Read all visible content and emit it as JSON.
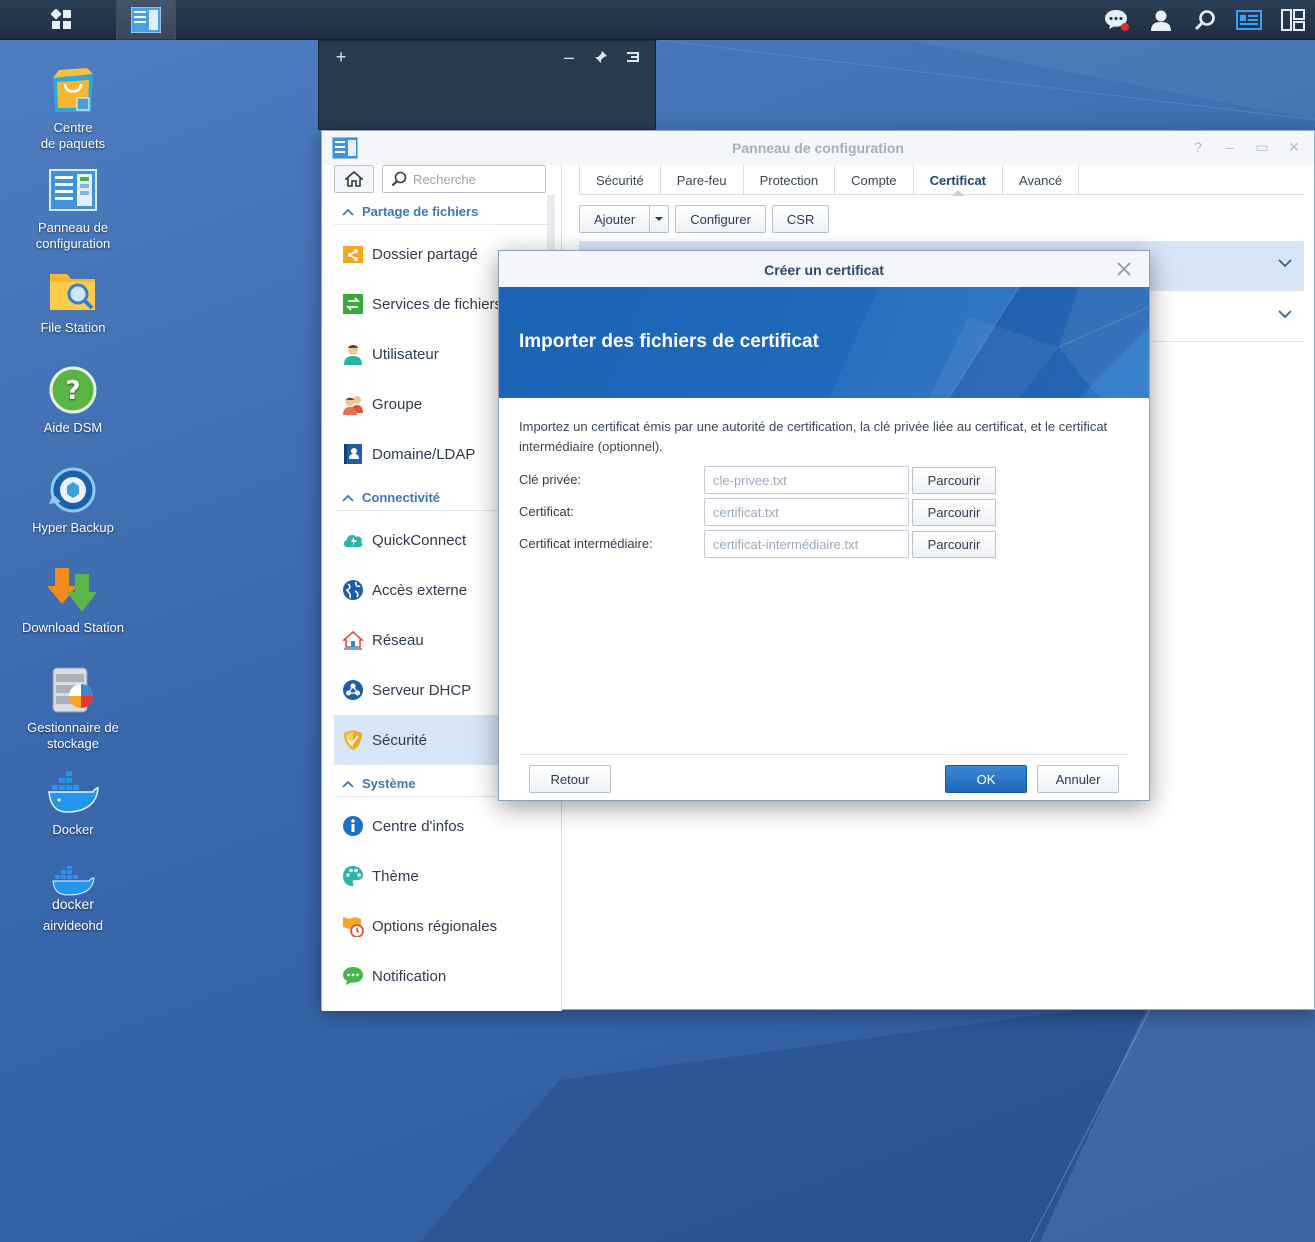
{
  "colors": {
    "accent": "#1f67b6",
    "desktop": "#3d6db0",
    "section_header": "#3e77b8",
    "active_item_bg": "#d7e6f6"
  },
  "taskbar": {
    "left_icons": [
      "main-menu-icon",
      "control-panel-app-icon"
    ],
    "right_icons": [
      "notification-chat-icon",
      "user-icon",
      "search-icon",
      "widgets-icon",
      "desktop-layout-icon"
    ]
  },
  "widget_panel": {
    "icons": [
      "plus-icon",
      "minus-icon",
      "pin-icon",
      "menu-icon"
    ]
  },
  "desktop": {
    "icons": [
      {
        "label1": "Centre",
        "label2": "de paquets",
        "icon": "package-center-icon"
      },
      {
        "label1": "Panneau de",
        "label2": "configuration",
        "icon": "control-panel-icon"
      },
      {
        "label1": "File Station",
        "label2": "",
        "icon": "file-station-icon"
      },
      {
        "label1": "Aide DSM",
        "label2": "",
        "icon": "help-icon"
      },
      {
        "label1": "Hyper Backup",
        "label2": "",
        "icon": "hyper-backup-icon"
      },
      {
        "label1": "Download Station",
        "label2": "",
        "icon": "download-station-icon"
      },
      {
        "label1": "Gestionnaire de",
        "label2": "stockage",
        "icon": "storage-manager-icon"
      },
      {
        "label1": "Docker",
        "label2": "",
        "icon": "docker-icon"
      },
      {
        "label1": "airvideohd",
        "label2": "",
        "icon": "docker-container-icon",
        "sub": "docker"
      }
    ]
  },
  "control_panel": {
    "title": "Panneau de configuration",
    "search_placeholder": "Recherche",
    "sections": {
      "file_sharing": "Partage de fichiers",
      "connectivity": "Connectivité",
      "system": "Système"
    },
    "items": {
      "shared_folder": "Dossier partagé",
      "file_services": "Services de fichiers",
      "user": "Utilisateur",
      "group": "Groupe",
      "domain": "Domaine/LDAP",
      "quickconnect": "QuickConnect",
      "external_access": "Accès externe",
      "network": "Réseau",
      "dhcp": "Serveur DHCP",
      "security": "Sécurité",
      "info_center": "Centre d'infos",
      "theme": "Thème",
      "regional": "Options régionales",
      "notification": "Notification"
    },
    "tabs": [
      "Sécurité",
      "Pare-feu",
      "Protection",
      "Compte",
      "Certificat",
      "Avancé"
    ],
    "active_tab": "Certificat",
    "toolbar": {
      "add": "Ajouter",
      "configure": "Configurer",
      "csr": "CSR"
    }
  },
  "modal": {
    "title": "Créer un certificat",
    "banner_title": "Importer des fichiers de certificat",
    "description": "Importez un certificat émis par une autorité de certification, la clé privée liée au certificat, et le certificat intermédiaire (optionnel).",
    "fields": [
      {
        "label": "Clé privée:",
        "placeholder": "cle-privee.txt",
        "button": "Parcourir"
      },
      {
        "label": "Certificat:",
        "placeholder": "certificat.txt",
        "button": "Parcourir"
      },
      {
        "label": "Certificat intermédiaire:",
        "placeholder": "certificat-intermédiaire.txt",
        "button": "Parcourir"
      }
    ],
    "back": "Retour",
    "ok": "OK",
    "cancel": "Annuler"
  }
}
